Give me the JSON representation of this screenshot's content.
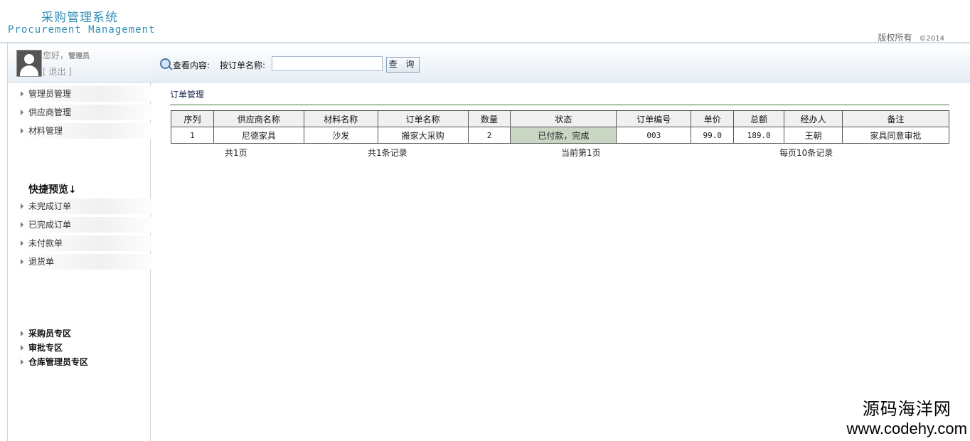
{
  "header": {
    "title_cn": "采购管理系统",
    "title_en": "Procurement Management",
    "copyright": "版权所有",
    "year": "©2014"
  },
  "user": {
    "greeting": "您好，",
    "name": "管理员",
    "logout": "[ 退出 ]"
  },
  "sidebar": {
    "items": [
      "管理员管理",
      "供应商管理",
      "材料管理"
    ],
    "quick_title": "快捷预览↓",
    "quick_items": [
      "未完成订单",
      "已完成订单",
      "未付款单",
      "退货单"
    ],
    "zones": [
      "采购员专区",
      "审批专区",
      "仓库管理员专区"
    ]
  },
  "search": {
    "label": "查看内容:",
    "field_label": "按订单名称:",
    "value": "",
    "button": "查 询"
  },
  "main": {
    "section_title": "订单管理",
    "columns": [
      "序列",
      "供应商名称",
      "材料名称",
      "订单名称",
      "数量",
      "状态",
      "订单编号",
      "单价",
      "总额",
      "经办人",
      "备注"
    ],
    "rows": [
      [
        "1",
        "尼德家具",
        "沙发",
        "搬家大采购",
        "2",
        "已付款，完成",
        "003",
        "99.0",
        "189.0",
        "王朝",
        "家具同意审批"
      ]
    ],
    "pager": {
      "pages": "共1页",
      "records": "共1条记录",
      "current": "当前第1页",
      "per_page": "每页10条记录"
    }
  },
  "watermark": {
    "line1": "源码海洋网",
    "line2": "www.codehy.com"
  }
}
